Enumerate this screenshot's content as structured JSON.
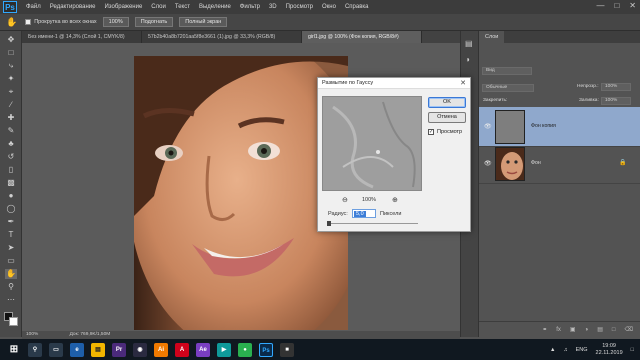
{
  "app": {
    "logo": "Ps"
  },
  "menu": [
    "Файл",
    "Редактирование",
    "Изображение",
    "Слои",
    "Текст",
    "Выделение",
    "Фильтр",
    "3D",
    "Просмотр",
    "Окно",
    "Справка"
  ],
  "options_bar": {
    "scroll_all": "Прокрутка во всех окнах",
    "zoom_btn": "100%",
    "fit_btn": "Подогнать",
    "fullscreen_btn": "Полный экран"
  },
  "tabs": [
    {
      "label": "Без имени-1 @ 14,3% (Слой 1, CMYK/8)",
      "active": false
    },
    {
      "label": "57b2b40a8b7201aa5f8e3661 (1).jpg @ 33,3% (RGB/8)",
      "active": false
    },
    {
      "label": "girl1.jpg @ 100% (Фон копия, RGB/8#)",
      "active": true
    }
  ],
  "status": {
    "zoom": "100%",
    "doc": "Док: 769,9K/1,50M"
  },
  "panel": {
    "tab": "Слои",
    "kind": "Вид",
    "blend": "Обычные",
    "opacity_label": "Непрозр.:",
    "opacity": "100%",
    "lock_label": "Закрепить:",
    "fill_label": "Заливка:",
    "fill": "100%",
    "layers": [
      {
        "name": "Фон копия",
        "active": true
      },
      {
        "name": "Фон",
        "active": false
      }
    ]
  },
  "dialog": {
    "title": "Размытие по Гауссу",
    "ok": "OK",
    "cancel": "Отмена",
    "preview_label": "Просмотр",
    "zoom": "100%",
    "radius_label": "Радиус:",
    "radius_value": "5,0",
    "units": "Пиксели",
    "preview_checked": true
  },
  "taskbar": {
    "time": "19:09",
    "date": "22.11.2019",
    "lang": "ENG"
  },
  "colors": {
    "accent": "#31a8ff",
    "layer_selected": "#8fa8cc"
  }
}
